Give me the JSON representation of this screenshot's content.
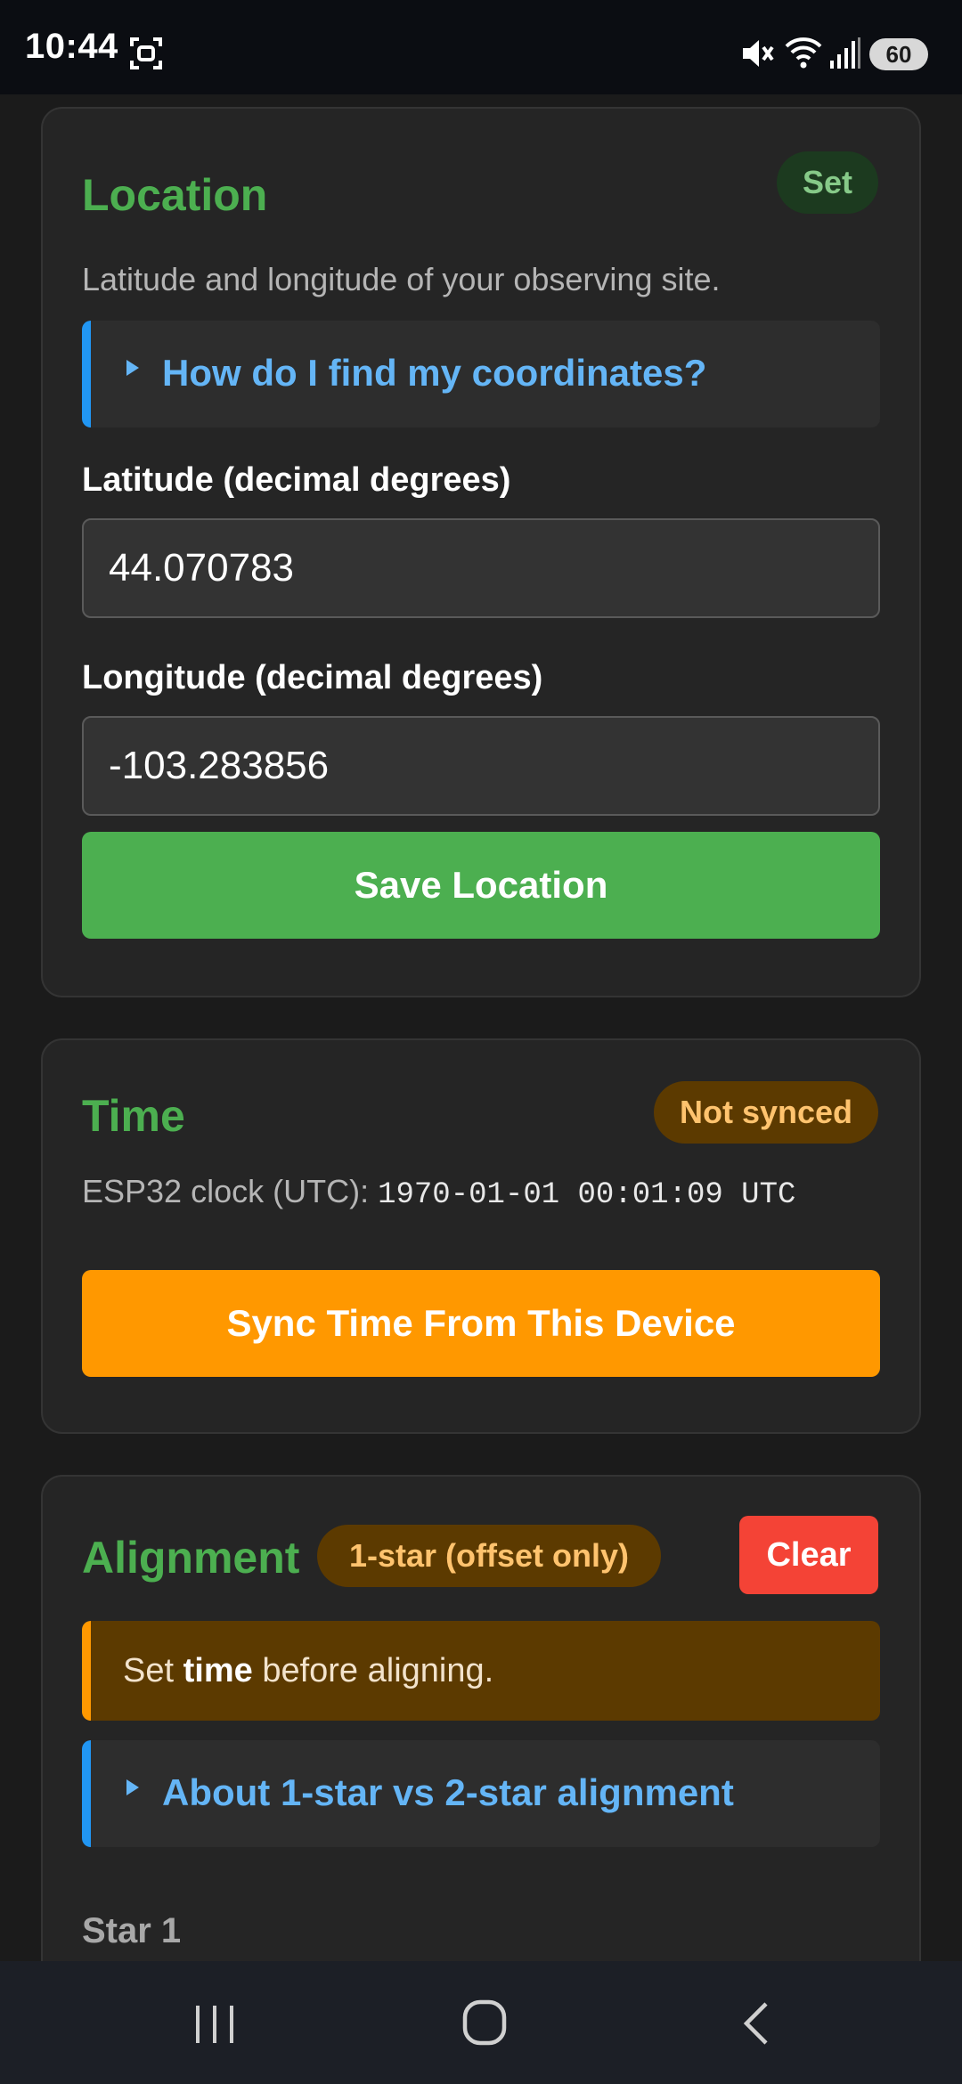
{
  "status_bar": {
    "time": "10:44",
    "battery": "60",
    "icons": [
      "screenshot-icon",
      "mute-icon",
      "wifi-icon",
      "signal-icon",
      "battery-icon"
    ]
  },
  "location": {
    "title": "Location",
    "badge": "Set",
    "description": "Latitude and longitude of your observing site.",
    "help_summary": "How do I find my coordinates?",
    "latitude_label": "Latitude (decimal degrees)",
    "latitude_value": "44.070783",
    "longitude_label": "Longitude (decimal degrees)",
    "longitude_value": "-103.283856",
    "save_button": "Save Location"
  },
  "time": {
    "title": "Time",
    "badge": "Not synced",
    "clock_label": "ESP32 clock (UTC):",
    "clock_value": "1970-01-01 00:01:09 UTC",
    "sync_button": "Sync Time From This Device"
  },
  "alignment": {
    "title": "Alignment",
    "mode_badge": "1-star (offset only)",
    "clear_button": "Clear",
    "warning_prefix": "Set",
    "warning_bold": "time",
    "warning_suffix": "before aligning.",
    "help_summary": "About 1-star vs 2-star alignment",
    "star1_label": "Star 1"
  },
  "colors": {
    "accent_green": "#4caf50",
    "accent_orange": "#ff9800",
    "danger_red": "#f44336",
    "link_blue": "#64b5f6",
    "background": "#1b1b1b",
    "card": "#252525"
  },
  "nav_bar": {
    "icons": [
      "recent-apps-icon",
      "home-icon",
      "back-icon"
    ]
  }
}
